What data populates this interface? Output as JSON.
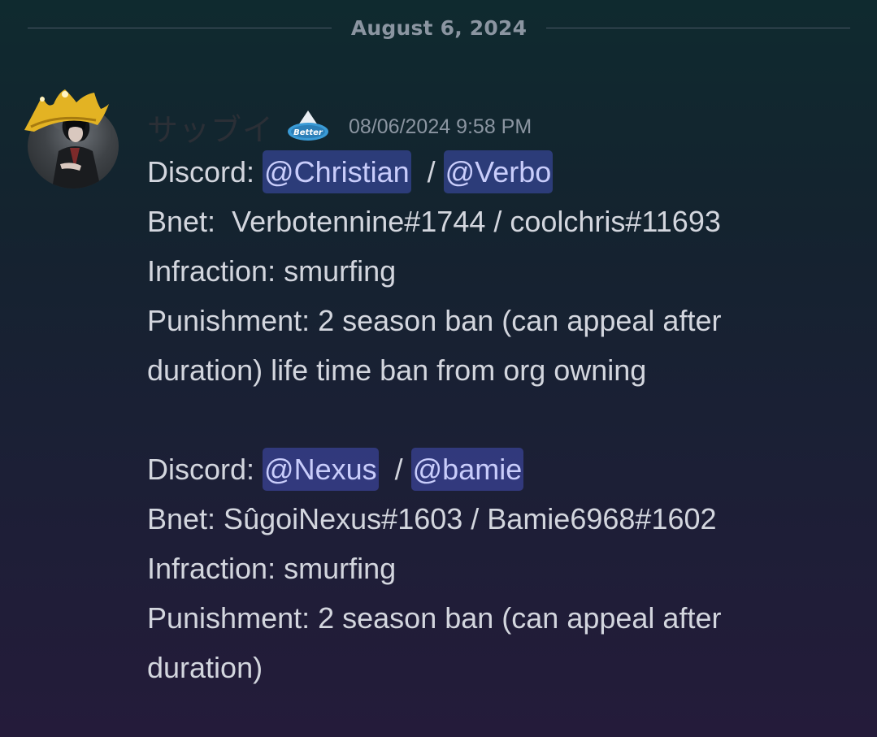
{
  "divider": {
    "date": "August 6, 2024"
  },
  "message": {
    "username": "サッブイ",
    "badge_icon": "team-logo-badge",
    "badge_text": "Better",
    "timestamp": "08/06/2024 9:58 PM",
    "block1": {
      "discord_label": "Discord: ",
      "mention1": "@Christian",
      "sep": "  / ",
      "mention2": "@Verbo",
      "bnet": "Bnet:  Verbotennine#1744 / coolchris#11693",
      "infraction": "Infraction: smurfing",
      "punishment_line1": "Punishment: 2 season ban (can appeal after",
      "punishment_line2": "duration) life time ban from org owning"
    },
    "block2": {
      "discord_label": "Discord: ",
      "mention1": "@Nexus",
      "sep": "  / ",
      "mention2": "@bamie",
      "bnet": "Bnet: SûgoiNexus#1603 / Bamie6968#1602",
      "infraction": "Infraction: smurfing",
      "punishment_line1": "Punishment: 2 season ban (can appeal after",
      "punishment_line2": "duration)"
    }
  },
  "colors": {
    "mention_bg": "#3c4288",
    "mention_text": "#c9cdfb",
    "body_text": "#d3d6de",
    "muted_text": "#8b95a1"
  }
}
